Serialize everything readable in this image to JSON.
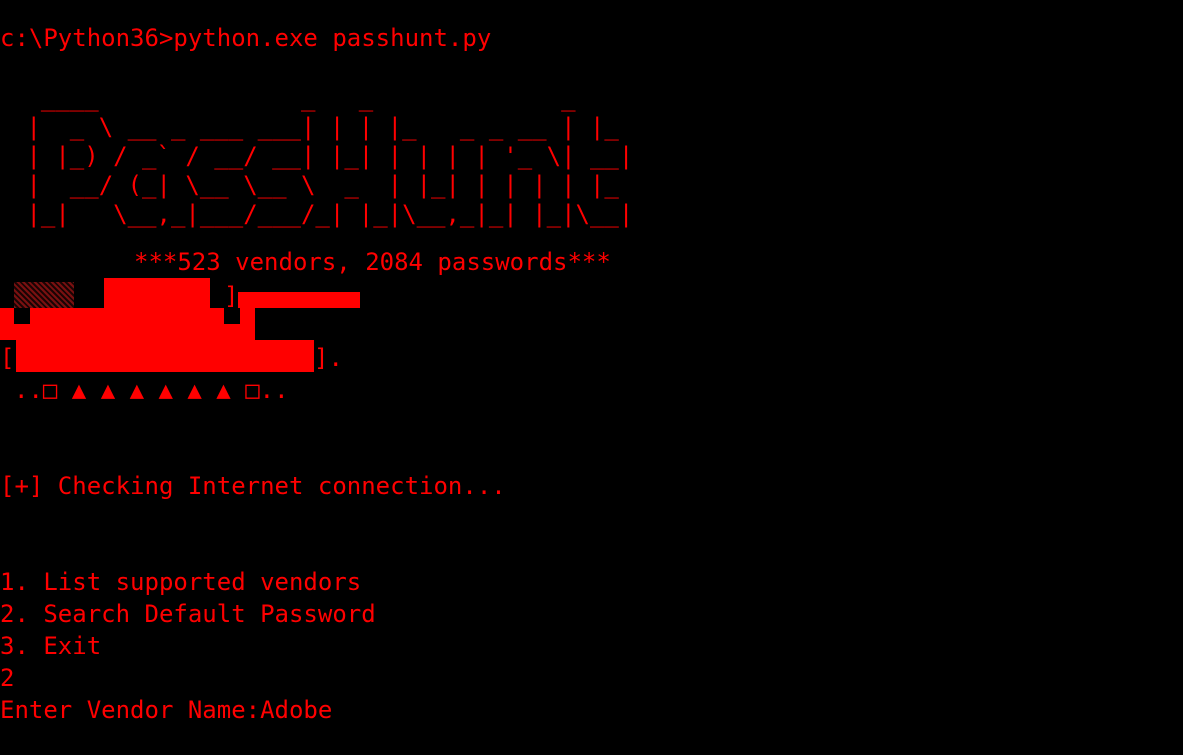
{
  "terminal": {
    "prompt_line": "c:\\Python36>python.exe passhunt.py",
    "banner_art": "  ____              _   _             _\n |  _ \\ __ _ ___ ___| | | |_   _ _ __ | |_\n | |_) / _` / __/ __| |_| | | | | '_ \\| __|\n |  __/ (_| \\__ \\__ \\  _  | |_| | | | | |_\n |_|   \\__,_|___/___/_| |_|\\__,_|_| |_|\\__|",
    "banner_subtitle": "***523 vendors, 2084 passwords***",
    "bracket_right_1": "]",
    "bracket_left_2": "[",
    "bracket_right_2": "].",
    "dots_line": "..□ ▲ ▲ ▲ ▲ ▲ ▲ □..",
    "status_line": "[+] Checking Internet connection...",
    "menu": {
      "item_1": "1. List supported vendors",
      "item_2": "2. Search Default Password",
      "item_3": "3. Exit"
    },
    "user_choice": "2",
    "vendor_prompt": "Enter Vendor Name:Adobe"
  },
  "colors": {
    "background": "#000000",
    "text": "#ff0000"
  }
}
